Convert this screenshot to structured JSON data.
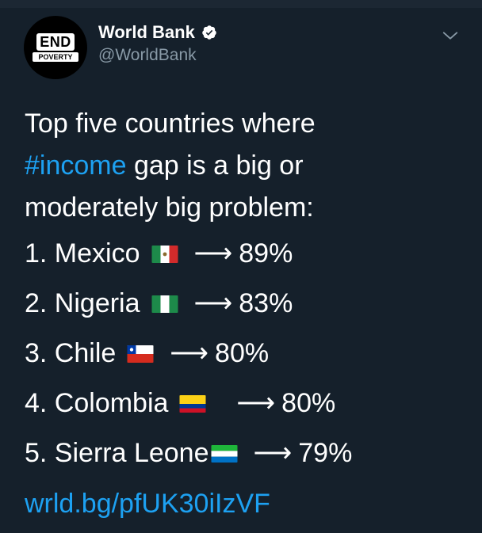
{
  "tweet": {
    "author_name": "World Bank",
    "author_handle": "@WorldBank",
    "avatar_text_top": "END",
    "avatar_text_bottom": "POVERTY",
    "text_line1": "Top five countries where",
    "hashtag": "#income",
    "text_line2_rest": " gap is a big or",
    "text_line3": "moderately big problem:",
    "rankings": [
      {
        "label": "1. Mexico",
        "flag": "mexico-flag",
        "arrow": "⟶",
        "value": "89%"
      },
      {
        "label": "2. Nigeria",
        "flag": "nigeria-flag",
        "arrow": "⟶",
        "value": "83%"
      },
      {
        "label": "3. Chile",
        "flag": "chile-flag",
        "arrow": "⟶",
        "value": "80%"
      },
      {
        "label": "4. Colombia",
        "flag": "colombia-flag",
        "arrow": "⟶",
        "value": "80%"
      },
      {
        "label": "5. Sierra Leone",
        "flag": "sierra-leone-flag",
        "arrow": "⟶",
        "value": "79%"
      }
    ],
    "link": "wrld.bg/pfUK30iIzVF"
  },
  "colors": {
    "background": "#15202b",
    "text": "#ffffff",
    "secondary": "#8899a6",
    "link": "#1da1f2"
  },
  "icons": [
    "verified-badge-icon",
    "chevron-down-icon"
  ]
}
